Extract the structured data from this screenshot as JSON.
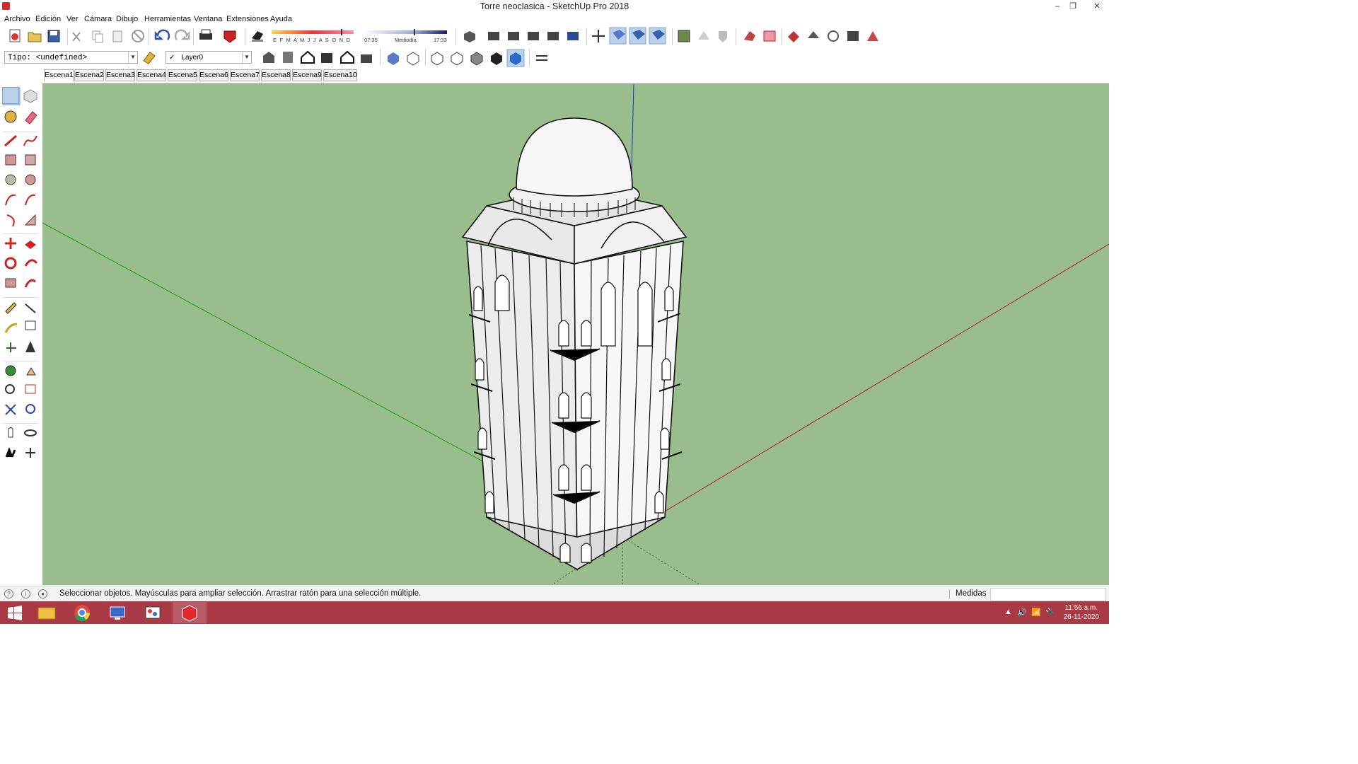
{
  "window": {
    "title": "Torre neoclasica - SketchUp Pro 2018",
    "minimize": "‒",
    "restore": "❐",
    "close": "✕"
  },
  "menu": [
    "Archivo",
    "Edición",
    "Ver",
    "Cámara",
    "Dibujo",
    "Herramientas",
    "Ventana",
    "Extensiones",
    "Ayuda"
  ],
  "shadows": {
    "months": "E F M A M J J A S O N D",
    "time_start": "07:35",
    "time_mid": "Mediodía",
    "time_end": "17:33"
  },
  "type_selector": {
    "value": "Tipo: <undefined>"
  },
  "layer_selector": {
    "check": "✓",
    "value": "Layer0"
  },
  "scenes": [
    "Escena1",
    "Escena2",
    "Escena3",
    "Escena4",
    "Escena5",
    "Escena6",
    "Escena7",
    "Escena8",
    "Escena9",
    "Escena10"
  ],
  "active_scene": "Escena1",
  "status": {
    "message": "Seleccionar objetos. Mayúsculas para ampliar selección. Arrastrar ratón para una selección múltiple.",
    "measurements_label": "Medidas",
    "measurements_value": ""
  },
  "clock": {
    "time": "11:56 a.m.",
    "date": "26-11-2020"
  },
  "colors": {
    "viewport": "#99bd8d",
    "red_axis": "#b02020",
    "green_axis": "#1f9a1f",
    "blue_axis": "#2030c0",
    "taskbar": "#a93a45"
  }
}
